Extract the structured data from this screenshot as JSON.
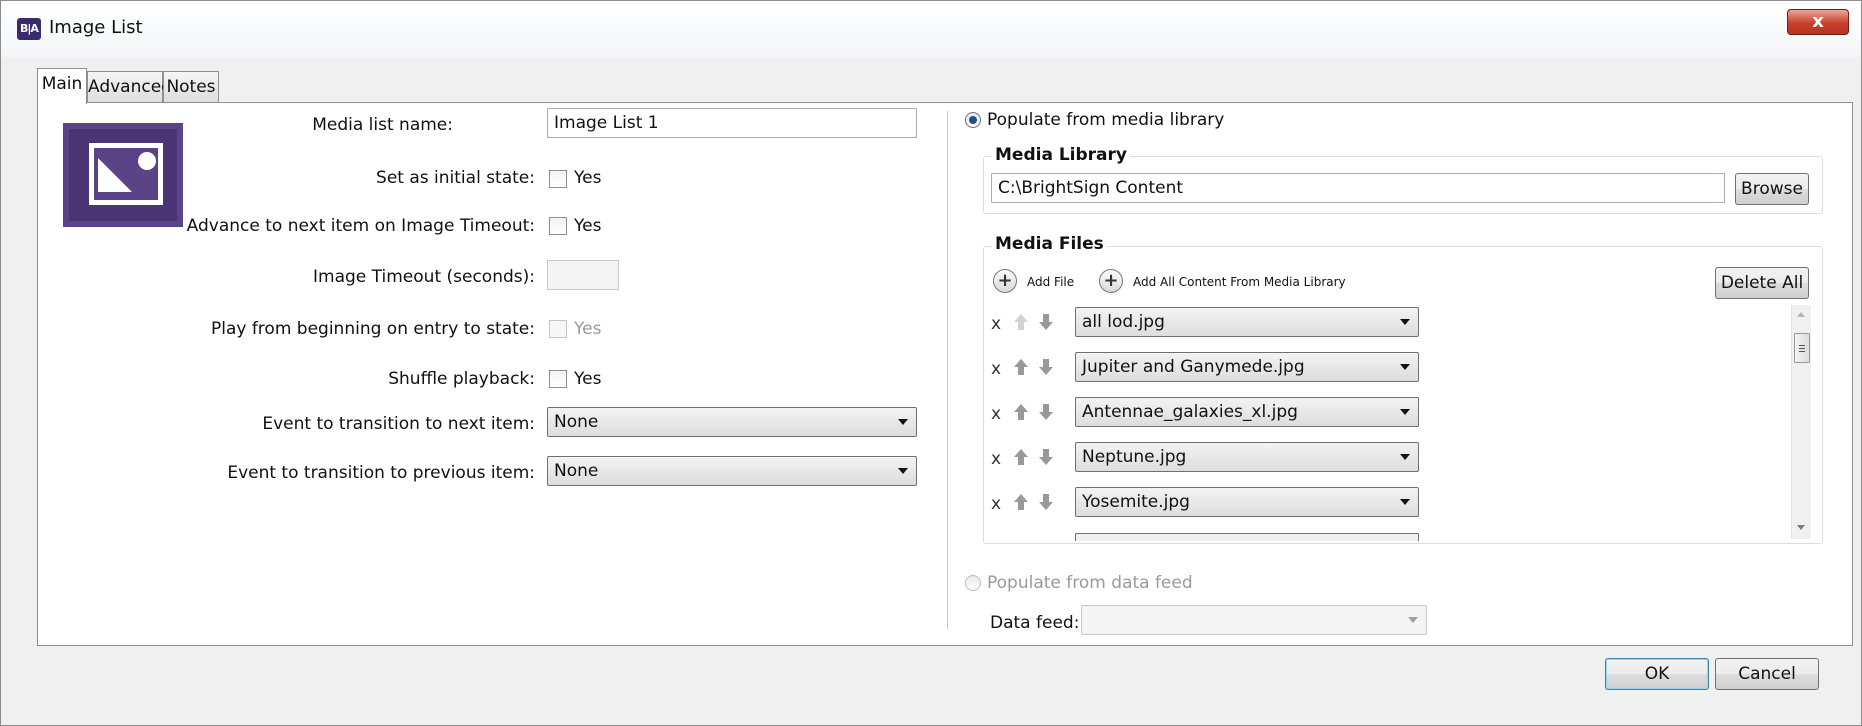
{
  "window": {
    "app_icon_text": "B|A",
    "title": "Image List",
    "close_glyph": "x"
  },
  "tabs": [
    {
      "label": "Main",
      "active": true
    },
    {
      "label": "Advanced",
      "active": false
    },
    {
      "label": "Notes",
      "active": false
    }
  ],
  "logo_icon": "image-list-icon",
  "main": {
    "media_list_name_label": "Media list name:",
    "media_list_name_value": "Image List 1",
    "initial_state_label": "Set as initial state:",
    "initial_state_cb": "Yes",
    "initial_state_checked": false,
    "advance_label": "Advance to next item on Image Timeout:",
    "advance_cb": "Yes",
    "advance_checked": false,
    "timeout_label": "Image Timeout (seconds):",
    "timeout_value": "",
    "play_from_beginning_label": "Play from beginning on entry to state:",
    "play_from_beginning_cb": "Yes",
    "play_from_beginning_enabled": false,
    "shuffle_label": "Shuffle playback:",
    "shuffle_cb": "Yes",
    "shuffle_checked": false,
    "next_event_label": "Event to transition to next item:",
    "next_event_value": "None",
    "prev_event_label": "Event to transition to previous item:",
    "prev_event_value": "None"
  },
  "right": {
    "populate_library_label": "Populate from media library",
    "populate_library_selected": true,
    "media_library_title": "Media Library",
    "media_library_path": "C:\\BrightSign Content",
    "browse_label": "Browse",
    "media_files_title": "Media Files",
    "add_file_label": "Add File",
    "add_all_label": "Add All Content From Media Library",
    "delete_all_label": "Delete All",
    "remove_glyph": "x",
    "files": [
      {
        "name": "all lod.jpg"
      },
      {
        "name": "Jupiter and Ganymede.jpg"
      },
      {
        "name": "Antennae_galaxies_xl.jpg"
      },
      {
        "name": "Neptune.jpg"
      },
      {
        "name": "Yosemite.jpg"
      }
    ],
    "populate_feed_label": "Populate from data feed",
    "populate_feed_selected": false,
    "data_feed_label": "Data feed:",
    "data_feed_value": ""
  },
  "footer": {
    "ok_label": "OK",
    "cancel_label": "Cancel"
  }
}
